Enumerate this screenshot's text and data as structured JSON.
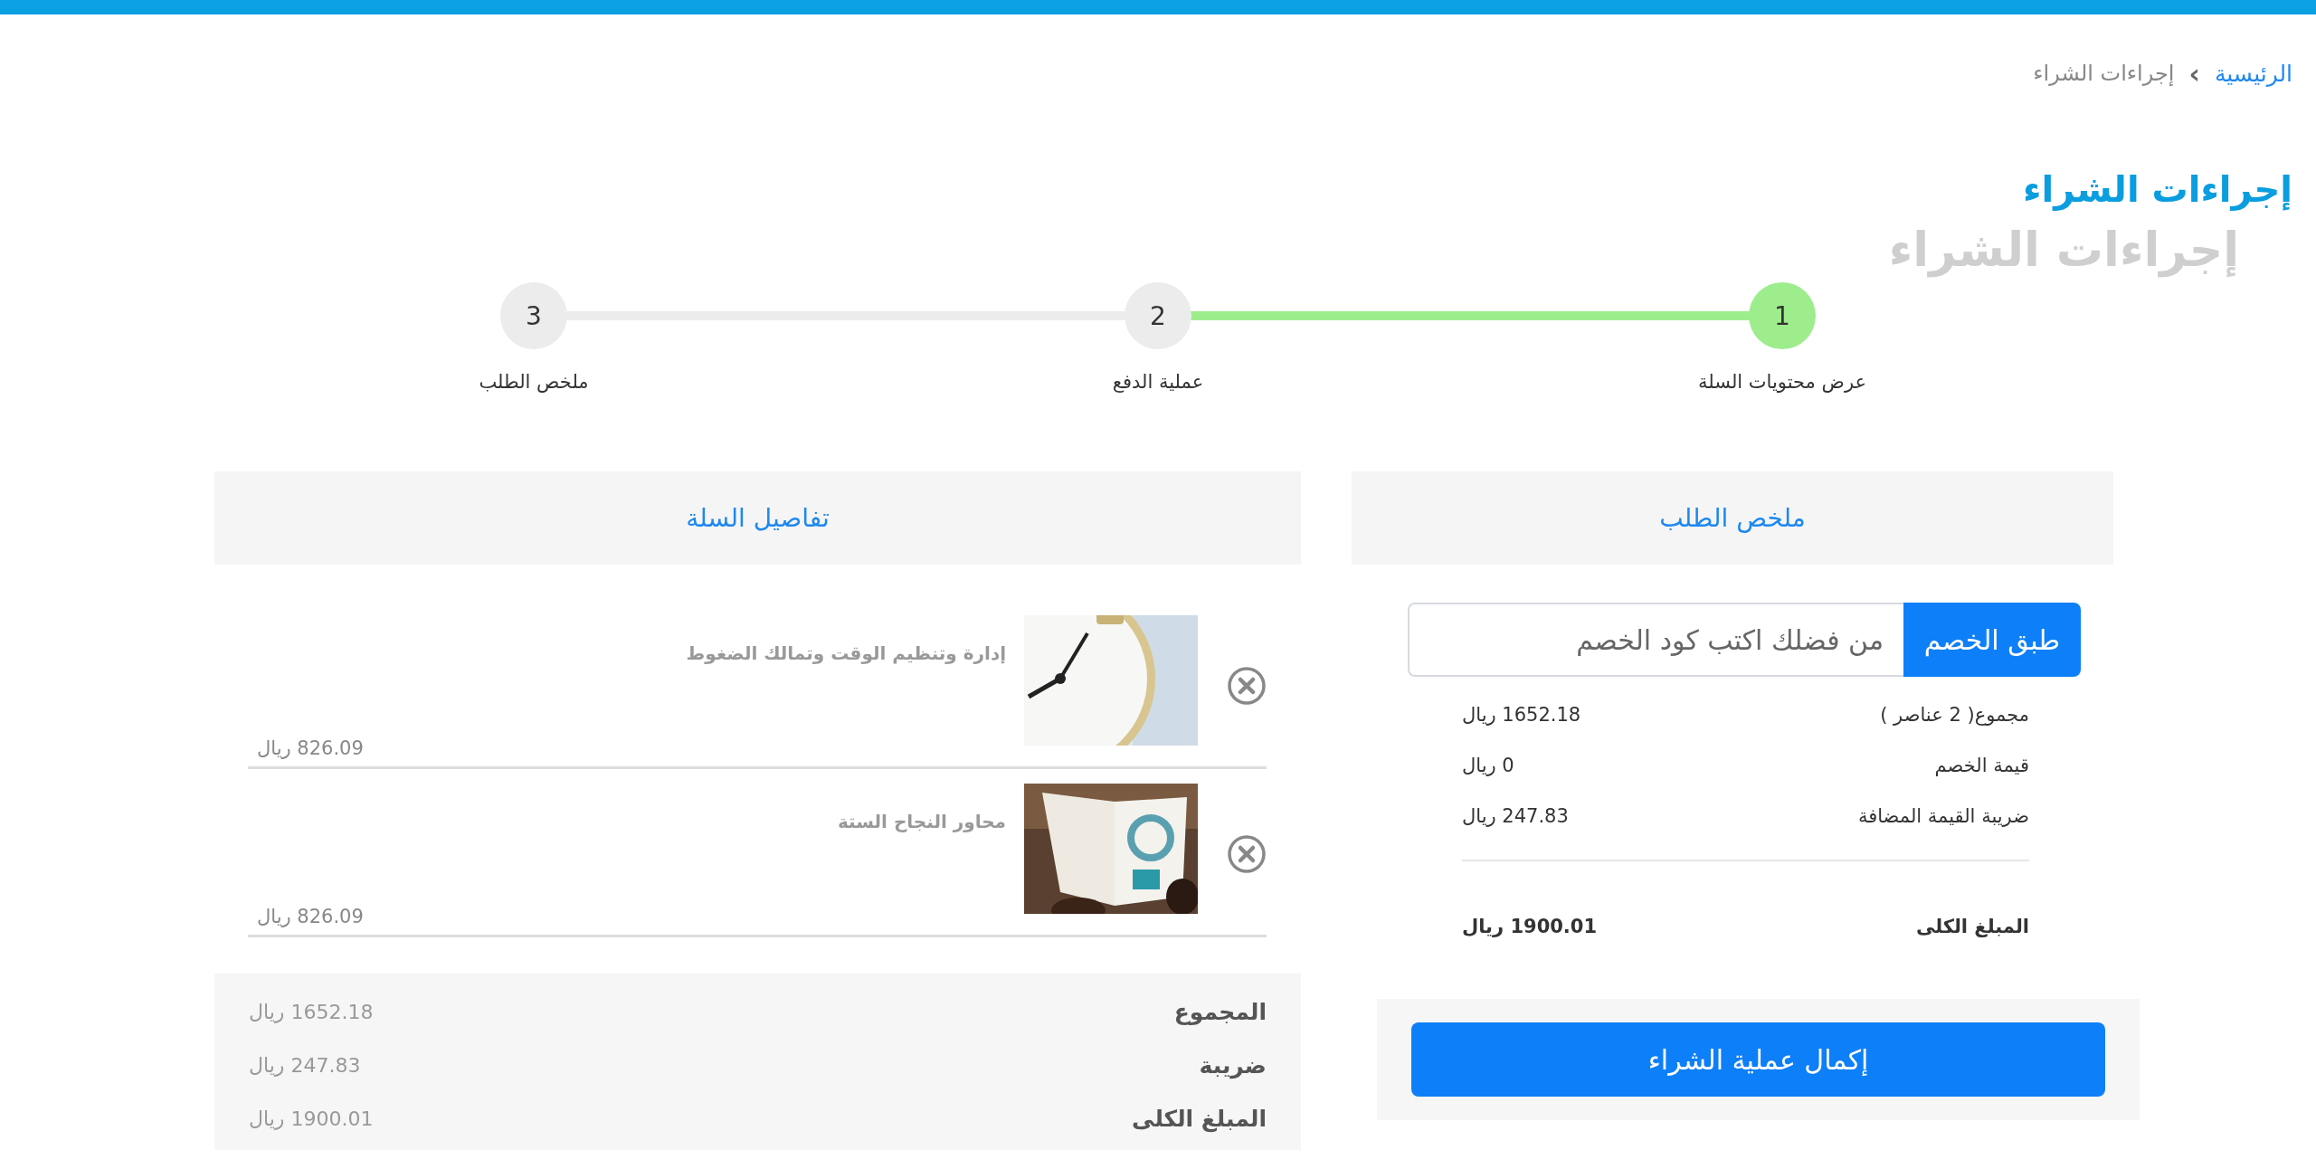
{
  "breadcrumb": {
    "home": "الرئيسية",
    "separator": "›",
    "current": "إجراءات الشراء"
  },
  "title": {
    "text": "إجراءات الشراء",
    "shadow_text": "إجراءات الشراء"
  },
  "steps": [
    {
      "number": "1",
      "label": "عرض محتويات السلة",
      "done": true
    },
    {
      "number": "2",
      "label": "عملية الدفع",
      "done": false
    },
    {
      "number": "3",
      "label": "ملخص الطلب",
      "done": false
    }
  ],
  "order_summary": {
    "heading": "ملخص الطلب",
    "coupon_button": "طبق الخصم",
    "coupon_placeholder": "من فضلك اكتب كود الخصم",
    "rows": [
      {
        "label": "مجموع( 2 عناصر )",
        "value": "1652.18 ريال"
      },
      {
        "label": "قيمة الخصم",
        "value": "0 ريال"
      },
      {
        "label": "ضريبة القيمة المضافة",
        "value": "247.83 ريال"
      }
    ],
    "total": {
      "label": "المبلغ الكلى",
      "value": "1900.01 ريال"
    },
    "checkout_button": "إكمال عملية الشراء"
  },
  "cart": {
    "heading": "تفاصيل السلة",
    "items": [
      {
        "title": "إدارة وتنظيم الوقت وتمالك الضغوط",
        "price": "826.09 ريال"
      },
      {
        "title": "محاور النجاح الستة",
        "price": "826.09 ريال"
      }
    ],
    "totals": [
      {
        "label": "المجموع",
        "value": "1652.18 ريال"
      },
      {
        "label": "ضريبة",
        "value": "247.83 ريال"
      },
      {
        "label": "المبلغ الكلى",
        "value": "1900.01 ريال"
      }
    ]
  }
}
